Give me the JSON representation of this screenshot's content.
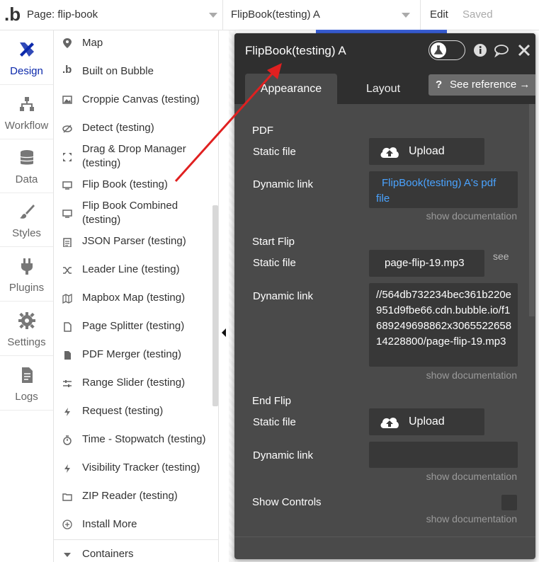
{
  "topbar": {
    "page_label": "Page: flip-book",
    "element_label": "FlipBook(testing) A",
    "edit_label": "Edit",
    "saved_label": "Saved"
  },
  "leftnav": [
    {
      "label": "Design",
      "icon": "design-icon",
      "active": true
    },
    {
      "label": "Workflow",
      "icon": "workflow-icon",
      "active": false
    },
    {
      "label": "Data",
      "icon": "database-icon",
      "active": false
    },
    {
      "label": "Styles",
      "icon": "brush-icon",
      "active": false
    },
    {
      "label": "Plugins",
      "icon": "plug-icon",
      "active": false
    },
    {
      "label": "Settings",
      "icon": "gear-icon",
      "active": false
    },
    {
      "label": "Logs",
      "icon": "document-icon",
      "active": false
    }
  ],
  "elements": [
    {
      "label": "Map",
      "icon": "map-pin-icon"
    },
    {
      "label": "Built on Bubble",
      "icon": "bubble-logo-icon"
    },
    {
      "label": "Croppie Canvas (testing)",
      "icon": "image-icon"
    },
    {
      "label": "Detect (testing)",
      "icon": "eye-off-icon"
    },
    {
      "label": "Drag & Drop Manager (testing)",
      "icon": "move-icon"
    },
    {
      "label": "Flip Book (testing)",
      "icon": "monitor-icon"
    },
    {
      "label": "Flip Book Combined (testing)",
      "icon": "monitor-icon"
    },
    {
      "label": "JSON Parser (testing)",
      "icon": "clipboard-icon"
    },
    {
      "label": "Leader Line (testing)",
      "icon": "shuffle-icon"
    },
    {
      "label": "Mapbox Map (testing)",
      "icon": "map-icon"
    },
    {
      "label": "Page Splitter (testing)",
      "icon": "file-icon"
    },
    {
      "label": "PDF Merger (testing)",
      "icon": "pdf-file-icon"
    },
    {
      "label": "Range Slider (testing)",
      "icon": "sliders-icon"
    },
    {
      "label": "Request (testing)",
      "icon": "bolt-icon"
    },
    {
      "label": "Time - Stopwatch (testing)",
      "icon": "stopwatch-icon"
    },
    {
      "label": "Visibility Tracker (testing)",
      "icon": "bolt-icon"
    },
    {
      "label": "ZIP Reader (testing)",
      "icon": "folder-icon"
    },
    {
      "label": "Install More",
      "icon": "plus-circle-icon"
    },
    {
      "label": "Containers",
      "icon": "triangle-down-icon"
    }
  ],
  "panel": {
    "title": "FlipBook(testing) A",
    "tabs": [
      {
        "label": "Appearance",
        "active": true
      },
      {
        "label": "Layout",
        "active": false
      }
    ],
    "see_reference": "See reference →",
    "see_reference_q": "?",
    "show_documentation": "show documentation",
    "sections": {
      "pdf": {
        "title": "PDF",
        "static_label": "Static file",
        "upload_label": "Upload",
        "dynamic_label": "Dynamic link",
        "dynamic_value": "FlipBook(testing) A's pdf file"
      },
      "start_flip": {
        "title": "Start Flip",
        "static_label": "Static file",
        "static_value": "page-flip-19.mp3",
        "see_label": "see",
        "dynamic_label": "Dynamic link",
        "dynamic_value": "//564db732234bec361b220e951d9fbe66.cdn.bubble.io/f1689249698862x306552265814228800/page-flip-19.mp3"
      },
      "end_flip": {
        "title": "End Flip",
        "static_label": "Static file",
        "upload_label": "Upload",
        "dynamic_label": "Dynamic link",
        "dynamic_value": ""
      },
      "show_controls": {
        "label": "Show Controls"
      }
    }
  },
  "colors": {
    "accent": "#0c29ab",
    "panel_bg": "#4a4a4a",
    "panel_header": "#2f2f2f",
    "field_bg": "#383838",
    "link_blue": "#4aa3ff",
    "arrow_red": "#e02020"
  }
}
